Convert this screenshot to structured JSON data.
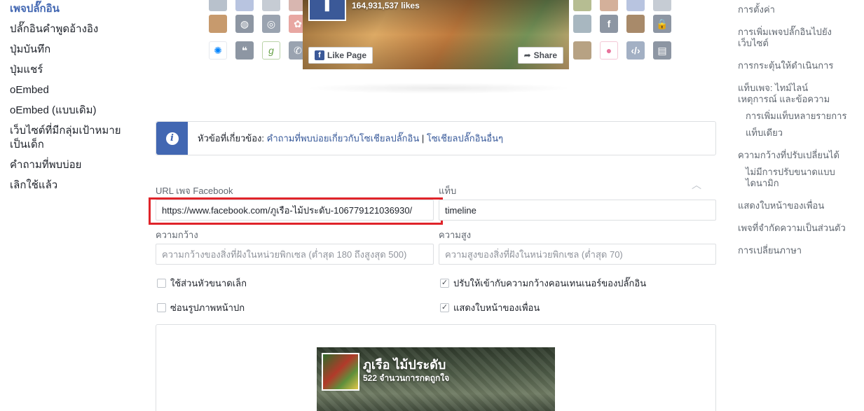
{
  "left_nav": {
    "items": [
      {
        "label": "เพจปลั๊กอิน",
        "active": true
      },
      {
        "label": "ปลั๊กอินคำพูดอ้างอิง"
      },
      {
        "label": "ปุ่มบันทึก"
      },
      {
        "label": "ปุ่มแชร์"
      },
      {
        "label": "oEmbed"
      },
      {
        "label": "oEmbed (แบบเดิม)"
      },
      {
        "label": "เว็บไซต์ที่มีกลุ่มเป้าหมายเป็นเด็ก"
      },
      {
        "label": "คำถามที่พบบ่อย"
      },
      {
        "label": "เลิกใช้แล้ว"
      }
    ]
  },
  "right_nav": {
    "items": [
      {
        "label": "การตั้งค่า"
      },
      {
        "label": "การเพิ่มเพจปลั๊กอินไปยังเว็บไซต์"
      },
      {
        "label": "การกระตุ้นให้ดำเนินการ"
      },
      {
        "label": "แท็บเพจ: ไทม์ไลน์ เหตุการณ์ และข้อความ"
      },
      {
        "label": "การเพิ่มแท็บหลายรายการ",
        "sub": true
      },
      {
        "label": "แท็บเดียว",
        "sub": true
      },
      {
        "label": "ความกว้างที่ปรับเปลี่ยนได้"
      },
      {
        "label": "ไม่มีการปรับขนาดแบบไดนามิก",
        "sub": true
      },
      {
        "label": "แสดงใบหน้าของเพื่อน"
      },
      {
        "label": "เพจที่จำกัดความเป็นส่วนตัว"
      },
      {
        "label": "การเปลี่ยนภาษา"
      }
    ]
  },
  "hero": {
    "likes": "164,931,537 likes",
    "like_button": "Like Page",
    "share_button": "Share",
    "fb_letter": "f"
  },
  "info": {
    "prefix": "หัวข้อที่เกี่ยวข้อง: ",
    "link1": "คำถามที่พบบ่อยเกี่ยวกับโซเชียลปลั๊กอิน",
    "separator": " | ",
    "link2": "โซเชียลปลั๊กอินอื่นๆ"
  },
  "form": {
    "url_label": "URL เพจ Facebook",
    "url_value": "https://www.facebook.com/ภูเรือ-ไม้ประดับ-106779121036930/",
    "tabs_label": "แท็บ",
    "tabs_value": "timeline",
    "width_label": "ความกว้าง",
    "width_placeholder": "ความกว้างของสิ่งที่ฝังในหน่วยพิกเซล (ต่ำสุด 180 ถึงสูงสุด 500)",
    "height_label": "ความสูง",
    "height_placeholder": "ความสูงของสิ่งที่ฝังในหน่วยพิกเซล (ต่ำสุด 70)",
    "small_header": {
      "label": "ใช้ส่วนหัวขนาดเล็ก",
      "checked": false
    },
    "hide_cover": {
      "label": "ซ่อนรูปภาพหน้าปก",
      "checked": false
    },
    "adapt_width": {
      "label": "ปรับให้เข้ากับความกว้างคอนเทนเนอร์ของปลั๊กอิน",
      "checked": true
    },
    "show_faces": {
      "label": "แสดงใบหน้าของเพื่อน",
      "checked": true
    }
  },
  "preview": {
    "page_name": "ภูเรือ ไม้ประดับ",
    "page_likes": "522 จำนวนการกดถูกใจ"
  },
  "colors": {
    "accent": "#4267b2",
    "highlight": "#e0242a"
  }
}
